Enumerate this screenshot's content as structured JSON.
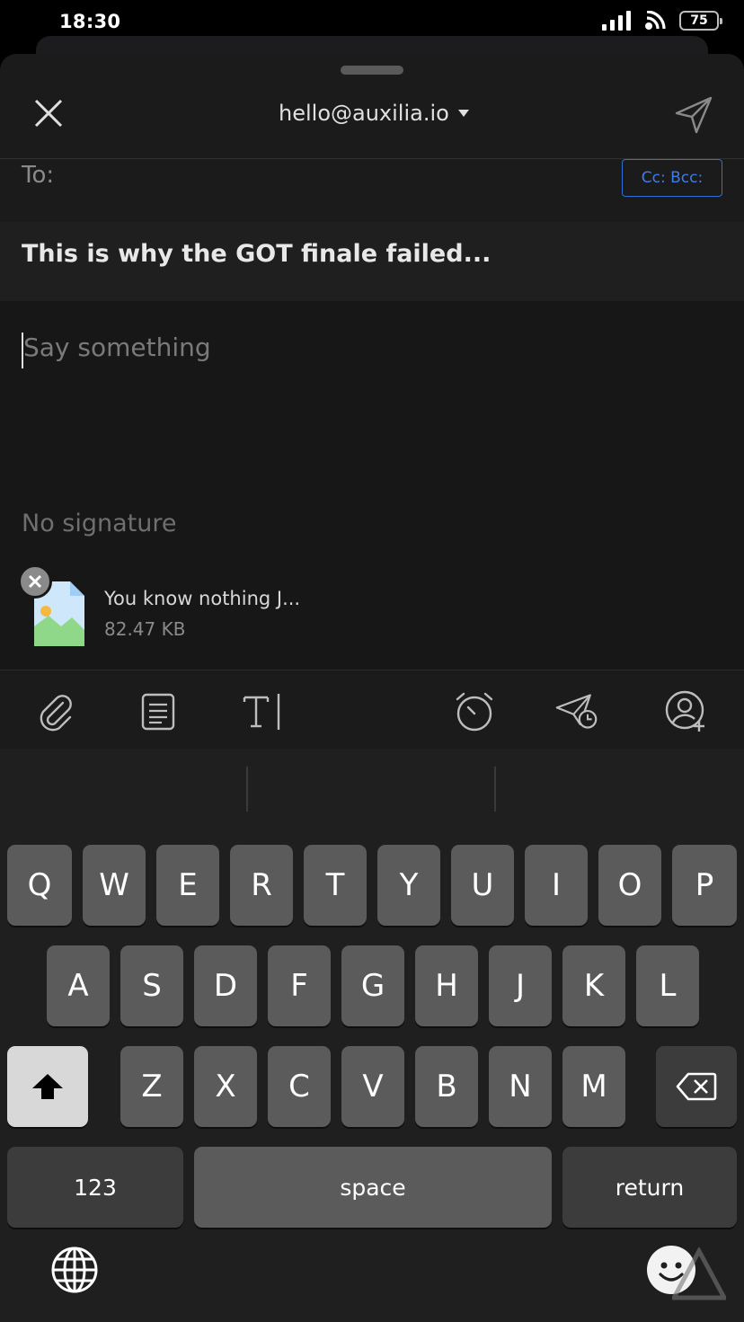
{
  "status": {
    "time": "18:30",
    "battery": "75"
  },
  "header": {
    "from_account": "hello@auxilia.io"
  },
  "compose": {
    "to_label": "To:",
    "cc_bcc_label": "Cc: Bcc:",
    "subject": "This is why the GOT finale failed...",
    "body_placeholder": "Say something",
    "signature": "No signature"
  },
  "attachment": {
    "name": "You know nothing J...",
    "size": "82.47 KB"
  },
  "toolbar": {
    "icons": [
      "paperclip-icon",
      "template-icon",
      "text-format-icon",
      "alarm-icon",
      "schedule-send-icon",
      "add-contact-icon"
    ]
  },
  "keyboard": {
    "row1": [
      "Q",
      "W",
      "E",
      "R",
      "T",
      "Y",
      "U",
      "I",
      "O",
      "P"
    ],
    "row2": [
      "A",
      "S",
      "D",
      "F",
      "G",
      "H",
      "J",
      "K",
      "L"
    ],
    "row3": [
      "Z",
      "X",
      "C",
      "V",
      "B",
      "N",
      "M"
    ],
    "numbers_label": "123",
    "space_label": "space",
    "return_label": "return"
  },
  "colors": {
    "accent": "#3a7ee8",
    "background": "#1b1b1b"
  }
}
